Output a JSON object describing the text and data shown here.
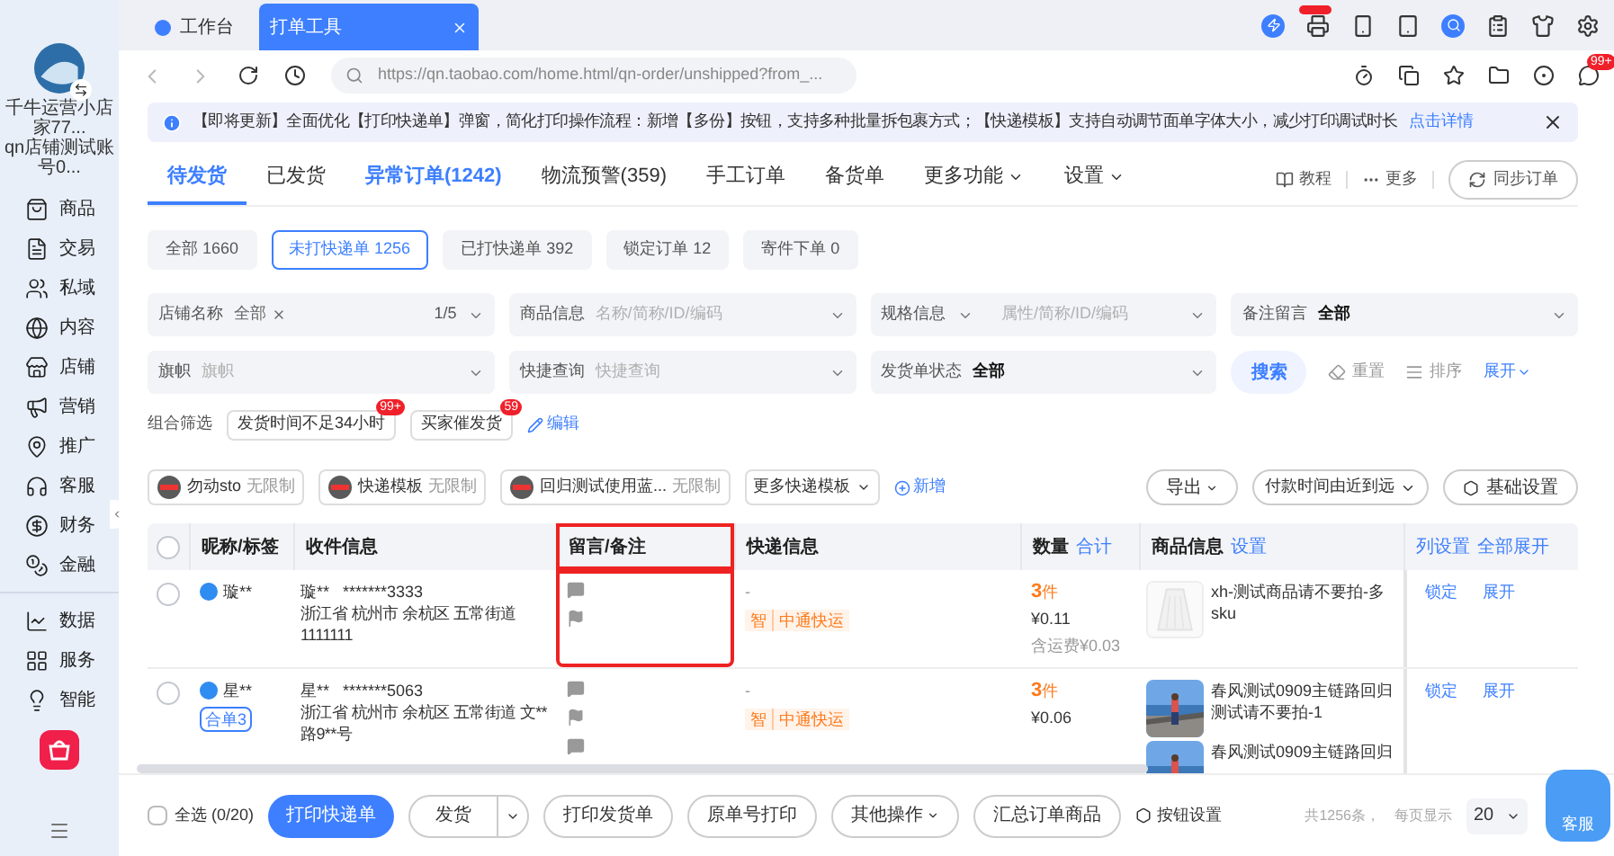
{
  "browser_tabs": [
    {
      "label": "工作台",
      "selected": false
    },
    {
      "label": "打单工具",
      "selected": true
    }
  ],
  "address_bar": {
    "url": "https://qn.taobao.com/home.html/qn-order/unshipped?from_..."
  },
  "toolbar_badge": "99+",
  "account": {
    "name": "千牛运营小店家77...",
    "sub": "qn店铺测试账号0..."
  },
  "sidebar": {
    "groups": [
      [
        {
          "label": "商品"
        },
        {
          "label": "交易"
        },
        {
          "label": "私域"
        },
        {
          "label": "内容"
        },
        {
          "label": "店铺"
        },
        {
          "label": "营销"
        },
        {
          "label": "推广"
        },
        {
          "label": "客服"
        },
        {
          "label": "财务"
        },
        {
          "label": "金融"
        }
      ],
      [
        {
          "label": "数据"
        },
        {
          "label": "服务"
        },
        {
          "label": "智能"
        }
      ]
    ]
  },
  "notice": {
    "text": "【即将更新】全面优化【打印快递单】弹窗，简化打印操作流程：新增【多份】按钮，支持多种批量拆包裹方式；【快递模板】支持自动调节面单字体大小，减少打印调试时长",
    "link": "点击详情"
  },
  "tabs": [
    {
      "label": "待发货",
      "selected": true,
      "kind": "plain"
    },
    {
      "label": "已发货",
      "selected": false,
      "kind": "plain"
    },
    {
      "label": "异常订单(1242)",
      "selected": false,
      "kind": "alert"
    },
    {
      "label": "物流预警(359)",
      "selected": false,
      "kind": "plain"
    },
    {
      "label": "手工订单",
      "selected": false,
      "kind": "plain"
    },
    {
      "label": "备货单",
      "selected": false,
      "kind": "plain"
    },
    {
      "label": "更多功能",
      "selected": false,
      "kind": "menu"
    },
    {
      "label": "设置",
      "selected": false,
      "kind": "menu"
    }
  ],
  "tab_actions": {
    "tutorial": "教程",
    "more": "更多",
    "sync": "同步订单"
  },
  "status_filters": [
    {
      "label": "全部 1660",
      "selected": false
    },
    {
      "label": "未打快递单 1256",
      "selected": true
    },
    {
      "label": "已打快递单 392",
      "selected": false
    },
    {
      "label": "锁定订单 12",
      "selected": false
    },
    {
      "label": "寄件下单 0",
      "selected": false
    }
  ],
  "filters": [
    {
      "kind": "tag",
      "label": "店铺名称",
      "value": "全部",
      "count": "1/5"
    },
    {
      "kind": "plain",
      "label": "商品信息",
      "placeholder": "名称/简称/ID/编码"
    },
    {
      "kind": "split",
      "label": "规格信息",
      "placeholder": "属性/简称/ID/编码"
    },
    {
      "kind": "plain",
      "label": "备注留言",
      "value": "全部"
    },
    {
      "kind": "plain",
      "label": "旗帜",
      "placeholder": "旗帜"
    },
    {
      "kind": "plain",
      "label": "快捷查询",
      "placeholder": "快捷查询"
    },
    {
      "kind": "plain",
      "label": "发货单状态",
      "value": "全部"
    }
  ],
  "search_actions": {
    "search": "搜索",
    "reset": "重置",
    "sort": "排序",
    "expand": "展开"
  },
  "combo_filters": {
    "label": "组合筛选",
    "items": [
      {
        "label": "发货时间不足34小时",
        "badge": "99+"
      },
      {
        "label": "买家催发货",
        "badge": "59"
      }
    ],
    "edit": "编辑"
  },
  "templates": [
    {
      "name": "勿动sto",
      "limit": "无限制"
    },
    {
      "name": "快递模板",
      "limit": "无限制"
    },
    {
      "name": "回归测试使用蓝...",
      "limit": "无限制"
    }
  ],
  "more_templates": "更多快递模板",
  "add_template": "新增",
  "list_actions": {
    "export": "导出",
    "sort": "付款时间由近到远",
    "settings": "基础设置"
  },
  "table": {
    "header_checked": false,
    "columns": [
      {
        "label": "昵称/标签",
        "highlighted": false
      },
      {
        "label": "收件信息",
        "highlighted": false
      },
      {
        "label": "留言/备注",
        "highlighted": true
      },
      {
        "label": "快递信息",
        "highlighted": false
      },
      {
        "label": "数量",
        "links": [
          "合计"
        ],
        "highlighted": false
      },
      {
        "label": "商品信息",
        "links": [
          "设置"
        ],
        "highlighted": false
      },
      {
        "links": [
          "列设置",
          "全部展开"
        ],
        "highlighted": false
      }
    ],
    "rows": [
      {
        "checked": false,
        "nickname": "璇**",
        "tags": [],
        "receiver": "璇**   *******3333",
        "address": "浙江省 杭州市 余杭区 五常街道 1111111",
        "remarks": [
          {
            "kind": "message"
          },
          {
            "kind": "flag"
          }
        ],
        "express": "-",
        "express_tags": [
          "智",
          "中通快运"
        ],
        "qty": "3",
        "unit": "件",
        "price": "¥0.11",
        "shipping": "含运费¥0.03",
        "products": [
          {
            "kind": "picture",
            "name": "xh-测试商品请不要拍-多sku"
          }
        ],
        "actions": [
          "锁定",
          "展开"
        ]
      },
      {
        "checked": false,
        "nickname": "星**",
        "tags": [
          "合单3"
        ],
        "receiver": "星**   *******5063",
        "address": "浙江省 杭州市 余杭区 五常街道 文**路9**号",
        "remarks": [
          {
            "kind": "message"
          },
          {
            "kind": "flag"
          },
          {
            "kind": "message"
          }
        ],
        "express": "-",
        "express_tags": [
          "智",
          "中通快运"
        ],
        "qty": "3",
        "unit": "件",
        "price": "¥0.06",
        "products": [
          {
            "kind": "picture",
            "name": "春风测试0909主链路回归测试请不要拍-1"
          },
          {
            "kind": "picture",
            "name": "春风测试0909主链路回归"
          }
        ],
        "actions": [
          "锁定",
          "展开"
        ]
      }
    ]
  },
  "bottom_bar": {
    "checked": false,
    "select_all": "全选 (0/20)",
    "buttons": [
      {
        "label": "打印快递单",
        "kind": "primary"
      },
      {
        "label": "发货",
        "kind": "split"
      },
      {
        "label": "打印发货单",
        "kind": "plain"
      },
      {
        "label": "原单号打印",
        "kind": "plain"
      },
      {
        "label": "其他操作",
        "kind": "menu"
      },
      {
        "label": "汇总订单商品",
        "kind": "plain"
      }
    ],
    "button_settings": "按钮设置",
    "total": "共1256条，",
    "page_size_label": "每页显示",
    "page_size": "20"
  },
  "assistant": {
    "label": "客服"
  }
}
